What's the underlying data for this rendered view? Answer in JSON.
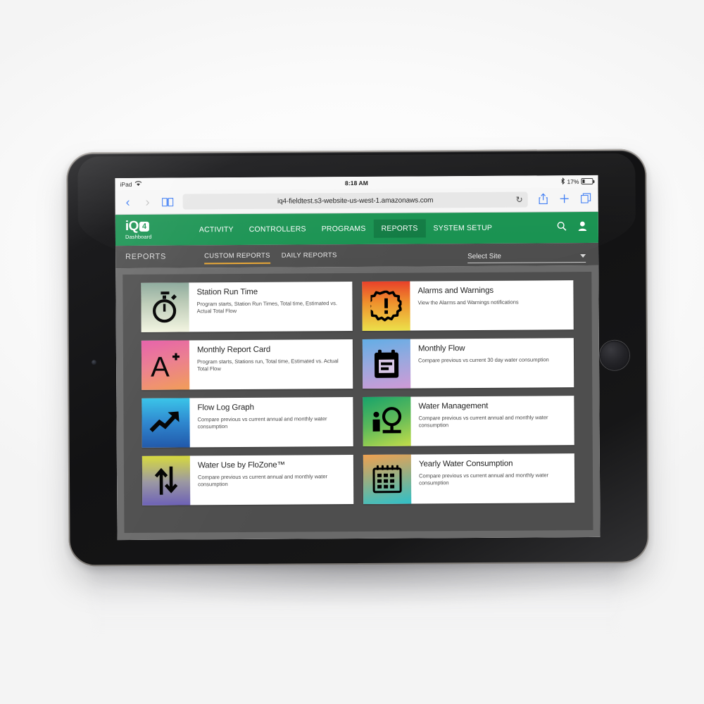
{
  "device": {
    "name": "iPad"
  },
  "status_bar": {
    "carrier": "iPad",
    "wifi_icon": "wifi-icon",
    "time": "8:18 AM",
    "bluetooth_icon": "bluetooth-icon",
    "battery_percent": "17%"
  },
  "browser": {
    "back_icon": "chevron-left-icon",
    "forward_icon": "chevron-right-icon",
    "bookmarks_icon": "book-icon",
    "url": "iq4-fieldtest.s3-website-us-west-1.amazonaws.com",
    "reload_icon": "reload-icon",
    "share_icon": "share-icon",
    "new_tab_icon": "plus-icon",
    "tabs_icon": "tabs-icon"
  },
  "appnav": {
    "brand": "iQ",
    "brand_badge": "4",
    "brand_sub": "Dashboard",
    "brand_color": "#16914f",
    "active_color": "#0f7a41",
    "items": [
      {
        "label": "ACTIVITY",
        "active": false
      },
      {
        "label": "CONTROLLERS",
        "active": false
      },
      {
        "label": "PROGRAMS",
        "active": false
      },
      {
        "label": "REPORTS",
        "active": true
      },
      {
        "label": "SYSTEM SETUP",
        "active": false
      }
    ],
    "search_icon": "search-icon",
    "account_icon": "user-icon"
  },
  "subnav": {
    "title": "REPORTS",
    "tabs": [
      {
        "label": "CUSTOM REPORTS",
        "active": true
      },
      {
        "label": "DAILY REPORTS",
        "active": false
      }
    ],
    "active_underline_color": "#e8a531",
    "site_select": {
      "value": "Select Site",
      "caret_icon": "chevron-down-icon"
    }
  },
  "reports": [
    {
      "id": "station-run-time",
      "title": "Station Run Time",
      "description": "Program starts, Station Run Times, Total time, Estimated vs. Actual Total Flow",
      "icon": "stopwatch-icon",
      "gradient_from": "#8aa89a",
      "gradient_to": "#f2f4e0"
    },
    {
      "id": "alarms-and-warnings",
      "title": "Alarms and Warnings",
      "description": "View the Alarms and Warnings notifications",
      "icon": "alert-burst-icon",
      "gradient_from": "#e8412a",
      "gradient_to": "#ece04a"
    },
    {
      "id": "monthly-report-card",
      "title": "Monthly Report Card",
      "description": "Program starts, Stations run, Total time, Estimated vs. Actual Total Flow",
      "icon": "a-plus-grade-icon",
      "gradient_from": "#e65ca8",
      "gradient_to": "#f29b54"
    },
    {
      "id": "monthly-flow",
      "title": "Monthly Flow",
      "description": "Compare previous vs current 30 day water consumption",
      "icon": "clipboard-calendar-icon",
      "gradient_from": "#62aee6",
      "gradient_to": "#cf9ad6"
    },
    {
      "id": "flow-log-graph",
      "title": "Flow Log Graph",
      "description": "Compare previous vs current annual and monthly water consumption",
      "icon": "trend-up-arrow-icon",
      "gradient_from": "#35c3e8",
      "gradient_to": "#1d55a8"
    },
    {
      "id": "water-management",
      "title": "Water Management",
      "description": "Compare previous vs current annual and monthly water consumption",
      "icon": "water-meter-icon",
      "gradient_from": "#17a36b",
      "gradient_to": "#c3dd4a"
    },
    {
      "id": "water-use-by-flozone",
      "title": "Water Use by FloZone™",
      "description": "Compare previous vs current annual and monthly water consumption",
      "icon": "up-down-arrows-icon",
      "gradient_from": "#d6d93a",
      "gradient_to": "#6b5fb5"
    },
    {
      "id": "yearly-water-consumption",
      "title": "Yearly Water Consumption",
      "description": "Compare previous vs current annual and monthly water consumption",
      "icon": "calendar-grid-icon",
      "gradient_from": "#f0a050",
      "gradient_to": "#2fc0c8"
    }
  ]
}
